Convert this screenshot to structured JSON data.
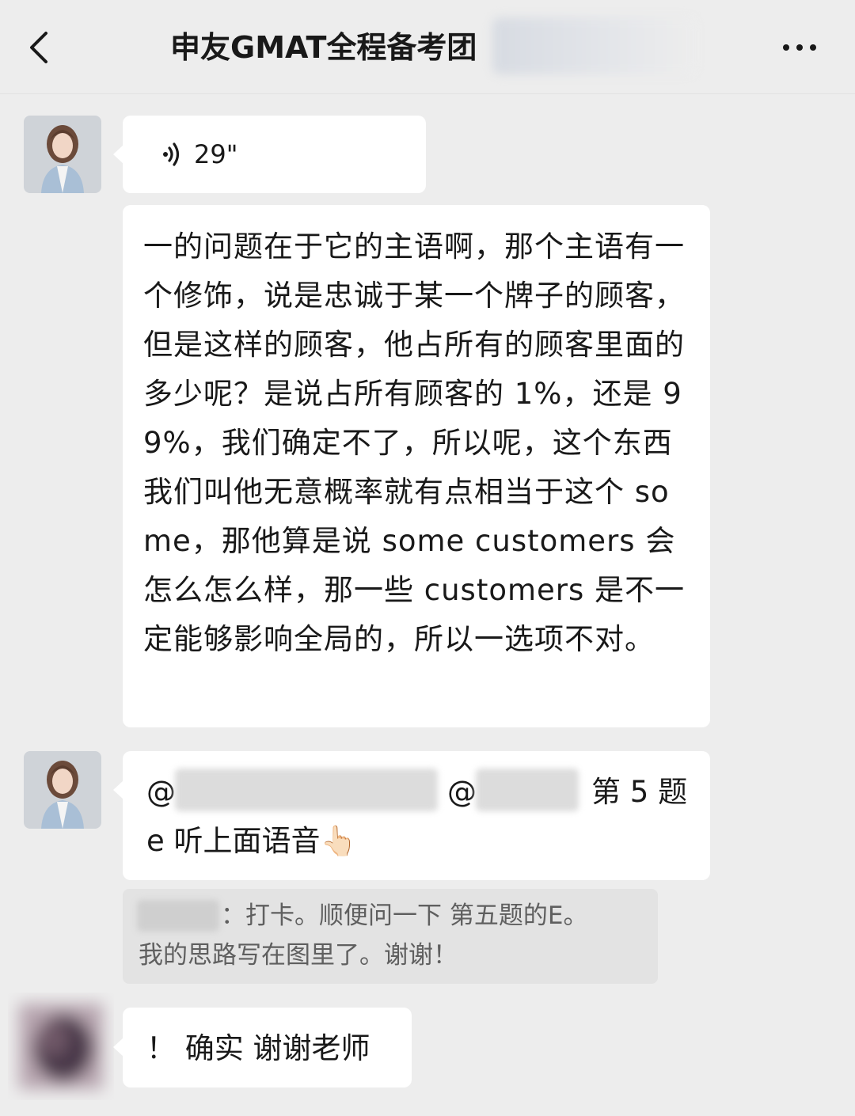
{
  "header": {
    "back_icon": "chevron-left-icon",
    "title": "申友GMAT全程备考团",
    "more_icon": "more-dots-icon"
  },
  "messages": {
    "voice": {
      "icon": "voice-wave-icon",
      "duration": "29\""
    },
    "transcript": {
      "text": "一的问题在于它的主语啊，那个主语有一个修饰，说是忠诚于某一个牌子的顾客，但是这样的顾客，他占所有的顾客里面的多少呢？是说占所有顾客的 1%，还是 99%，我们确定不了，所以呢，这个东西我们叫他无意概率就有点相当于这个 some，那他算是说 some customers 会怎么怎么样，那一些 customers 是不一定能够影响全局的，所以一选项不对。"
    },
    "mention": {
      "at_1": "@",
      "at_2": "@",
      "question_ref": "第 5 题",
      "line2": "e 听上面语音",
      "emoji": "👆🏻"
    },
    "quote": {
      "line1": "：打卡。顺便问一下 第五题的E。",
      "line2": "我的思路写在图里了。谢谢！"
    },
    "reply": {
      "text": "！ 确实 谢谢老师"
    }
  }
}
